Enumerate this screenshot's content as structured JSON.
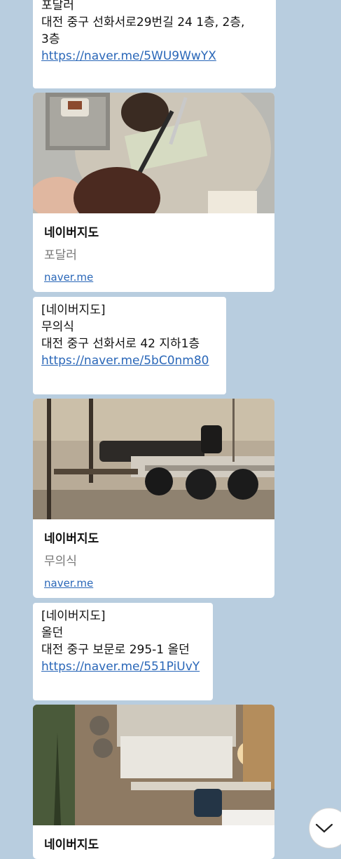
{
  "messages": [
    {
      "lines": [
        "포달러",
        "대전 중구 선화서로29번길 24 1층, 2층,",
        "3층"
      ],
      "link": "https://naver.me/5WU9WwYX"
    },
    {
      "lines": [
        "[네이버지도]",
        "무의식",
        "대전 중구 선화서로 42 지하1층"
      ],
      "link": "https://naver.me/5bC0nm80"
    },
    {
      "lines": [
        "[네이버지도]",
        "올던",
        "대전 중구 보문로 295-1 올던"
      ],
      "link": "https://naver.me/551PiUvY"
    }
  ],
  "cards": [
    {
      "title": "네이버지도",
      "subtitle": "포달러",
      "site": "naver.me",
      "image": "cafe-dessert-photo"
    },
    {
      "title": "네이버지도",
      "subtitle": "무의식",
      "site": "naver.me",
      "image": "cafe-interior-photo"
    },
    {
      "title": "네이버지도",
      "image": "cafe-window-photo"
    }
  ],
  "scroll_button": {
    "icon": "chevron-down-icon"
  }
}
